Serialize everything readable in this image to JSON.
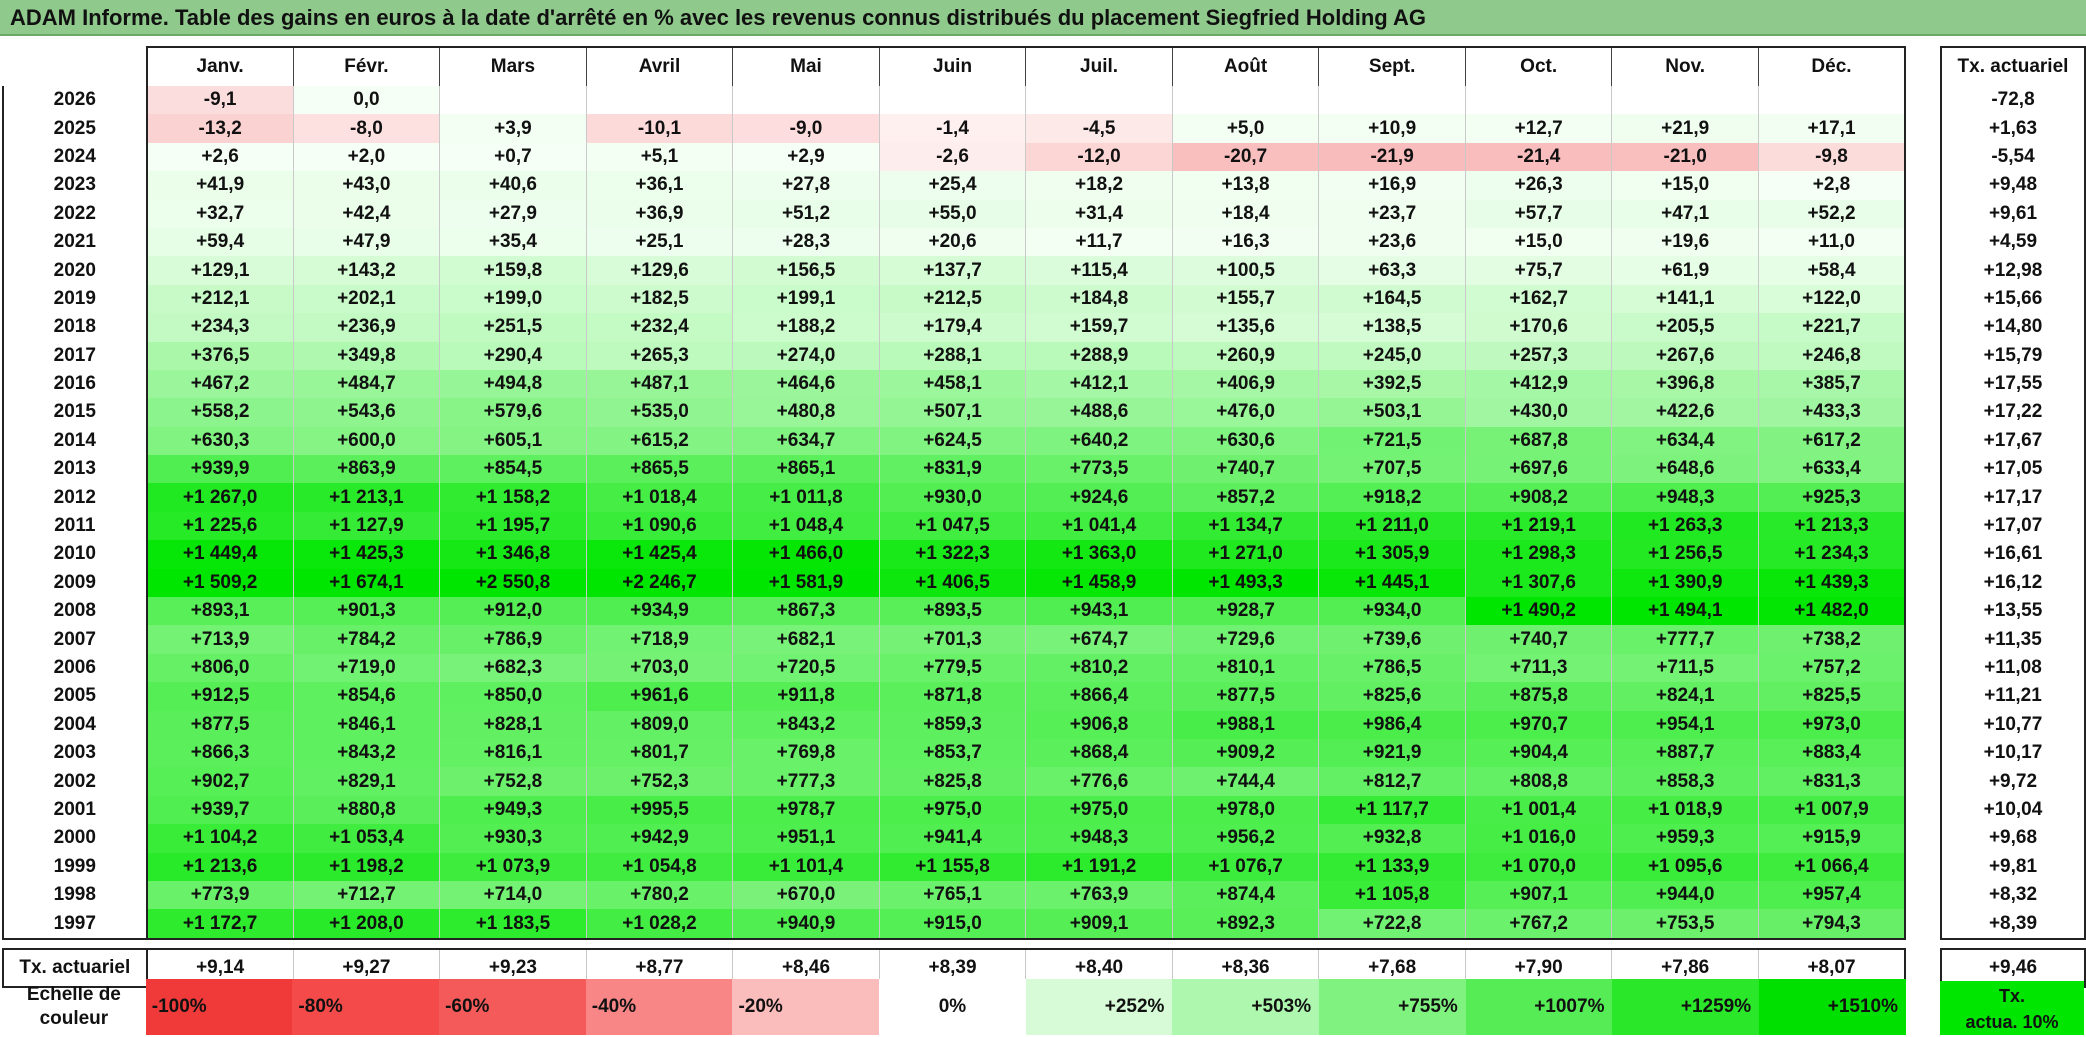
{
  "title": "ADAM Informe. Table des gains en euros à la date d'arrêté en % avec les revenus connus distribués du placement Siegfried Holding AG",
  "months": [
    "Janv.",
    "Févr.",
    "Mars",
    "Avril",
    "Mai",
    "Juin",
    "Juil.",
    "Août",
    "Sept.",
    "Oct.",
    "Nov.",
    "Déc."
  ],
  "side_header": "Tx. actuariel",
  "rows": [
    {
      "year": "2026",
      "cells": [
        "-9,1",
        "0,0",
        "",
        "",
        "",
        "",
        "",
        "",
        "",
        "",
        "",
        ""
      ],
      "tx": "-72,8"
    },
    {
      "year": "2025",
      "cells": [
        "-13,2",
        "-8,0",
        "+3,9",
        "-10,1",
        "-9,0",
        "-1,4",
        "-4,5",
        "+5,0",
        "+10,9",
        "+12,7",
        "+21,9",
        "+17,1"
      ],
      "tx": "+1,63"
    },
    {
      "year": "2024",
      "cells": [
        "+2,6",
        "+2,0",
        "+0,7",
        "+5,1",
        "+2,9",
        "-2,6",
        "-12,0",
        "-20,7",
        "-21,9",
        "-21,4",
        "-21,0",
        "-9,8"
      ],
      "tx": "-5,54"
    },
    {
      "year": "2023",
      "cells": [
        "+41,9",
        "+43,0",
        "+40,6",
        "+36,1",
        "+27,8",
        "+25,4",
        "+18,2",
        "+13,8",
        "+16,9",
        "+26,3",
        "+15,0",
        "+2,8"
      ],
      "tx": "+9,48"
    },
    {
      "year": "2022",
      "cells": [
        "+32,7",
        "+42,4",
        "+27,9",
        "+36,9",
        "+51,2",
        "+55,0",
        "+31,4",
        "+18,4",
        "+23,7",
        "+57,7",
        "+47,1",
        "+52,2"
      ],
      "tx": "+9,61"
    },
    {
      "year": "2021",
      "cells": [
        "+59,4",
        "+47,9",
        "+35,4",
        "+25,1",
        "+28,3",
        "+20,6",
        "+11,7",
        "+16,3",
        "+23,6",
        "+15,0",
        "+19,6",
        "+11,0"
      ],
      "tx": "+4,59"
    },
    {
      "year": "2020",
      "cells": [
        "+129,1",
        "+143,2",
        "+159,8",
        "+129,6",
        "+156,5",
        "+137,7",
        "+115,4",
        "+100,5",
        "+63,3",
        "+75,7",
        "+61,9",
        "+58,4"
      ],
      "tx": "+12,98"
    },
    {
      "year": "2019",
      "cells": [
        "+212,1",
        "+202,1",
        "+199,0",
        "+182,5",
        "+199,1",
        "+212,5",
        "+184,8",
        "+155,7",
        "+164,5",
        "+162,7",
        "+141,1",
        "+122,0"
      ],
      "tx": "+15,66"
    },
    {
      "year": "2018",
      "cells": [
        "+234,3",
        "+236,9",
        "+251,5",
        "+232,4",
        "+188,2",
        "+179,4",
        "+159,7",
        "+135,6",
        "+138,5",
        "+170,6",
        "+205,5",
        "+221,7"
      ],
      "tx": "+14,80"
    },
    {
      "year": "2017",
      "cells": [
        "+376,5",
        "+349,8",
        "+290,4",
        "+265,3",
        "+274,0",
        "+288,1",
        "+288,9",
        "+260,9",
        "+245,0",
        "+257,3",
        "+267,6",
        "+246,8"
      ],
      "tx": "+15,79"
    },
    {
      "year": "2016",
      "cells": [
        "+467,2",
        "+484,7",
        "+494,8",
        "+487,1",
        "+464,6",
        "+458,1",
        "+412,1",
        "+406,9",
        "+392,5",
        "+412,9",
        "+396,8",
        "+385,7"
      ],
      "tx": "+17,55"
    },
    {
      "year": "2015",
      "cells": [
        "+558,2",
        "+543,6",
        "+579,6",
        "+535,0",
        "+480,8",
        "+507,1",
        "+488,6",
        "+476,0",
        "+503,1",
        "+430,0",
        "+422,6",
        "+433,3"
      ],
      "tx": "+17,22"
    },
    {
      "year": "2014",
      "cells": [
        "+630,3",
        "+600,0",
        "+605,1",
        "+615,2",
        "+634,7",
        "+624,5",
        "+640,2",
        "+630,6",
        "+721,5",
        "+687,8",
        "+634,4",
        "+617,2"
      ],
      "tx": "+17,67"
    },
    {
      "year": "2013",
      "cells": [
        "+939,9",
        "+863,9",
        "+854,5",
        "+865,5",
        "+865,1",
        "+831,9",
        "+773,5",
        "+740,7",
        "+707,5",
        "+697,6",
        "+648,6",
        "+633,4"
      ],
      "tx": "+17,05"
    },
    {
      "year": "2012",
      "cells": [
        "+1 267,0",
        "+1 213,1",
        "+1 158,2",
        "+1 018,4",
        "+1 011,8",
        "+930,0",
        "+924,6",
        "+857,2",
        "+918,2",
        "+908,2",
        "+948,3",
        "+925,3"
      ],
      "tx": "+17,17"
    },
    {
      "year": "2011",
      "cells": [
        "+1 225,6",
        "+1 127,9",
        "+1 195,7",
        "+1 090,6",
        "+1 048,4",
        "+1 047,5",
        "+1 041,4",
        "+1 134,7",
        "+1 211,0",
        "+1 219,1",
        "+1 263,3",
        "+1 213,3"
      ],
      "tx": "+17,07"
    },
    {
      "year": "2010",
      "cells": [
        "+1 449,4",
        "+1 425,3",
        "+1 346,8",
        "+1 425,4",
        "+1 466,0",
        "+1 322,3",
        "+1 363,0",
        "+1 271,0",
        "+1 305,9",
        "+1 298,3",
        "+1 256,5",
        "+1 234,3"
      ],
      "tx": "+16,61"
    },
    {
      "year": "2009",
      "cells": [
        "+1 509,2",
        "+1 674,1",
        "+2 550,8",
        "+2 246,7",
        "+1 581,9",
        "+1 406,5",
        "+1 458,9",
        "+1 493,3",
        "+1 445,1",
        "+1 307,6",
        "+1 390,9",
        "+1 439,3"
      ],
      "tx": "+16,12"
    },
    {
      "year": "2008",
      "cells": [
        "+893,1",
        "+901,3",
        "+912,0",
        "+934,9",
        "+867,3",
        "+893,5",
        "+943,1",
        "+928,7",
        "+934,0",
        "+1 490,2",
        "+1 494,1",
        "+1 482,0"
      ],
      "tx": "+13,55"
    },
    {
      "year": "2007",
      "cells": [
        "+713,9",
        "+784,2",
        "+786,9",
        "+718,9",
        "+682,1",
        "+701,3",
        "+674,7",
        "+729,6",
        "+739,6",
        "+740,7",
        "+777,7",
        "+738,2"
      ],
      "tx": "+11,35"
    },
    {
      "year": "2006",
      "cells": [
        "+806,0",
        "+719,0",
        "+682,3",
        "+703,0",
        "+720,5",
        "+779,5",
        "+810,2",
        "+810,1",
        "+786,5",
        "+711,3",
        "+711,5",
        "+757,2"
      ],
      "tx": "+11,08"
    },
    {
      "year": "2005",
      "cells": [
        "+912,5",
        "+854,6",
        "+850,0",
        "+961,6",
        "+911,8",
        "+871,8",
        "+866,4",
        "+877,5",
        "+825,6",
        "+875,8",
        "+824,1",
        "+825,5"
      ],
      "tx": "+11,21"
    },
    {
      "year": "2004",
      "cells": [
        "+877,5",
        "+846,1",
        "+828,1",
        "+809,0",
        "+843,2",
        "+859,3",
        "+906,8",
        "+988,1",
        "+986,4",
        "+970,7",
        "+954,1",
        "+973,0"
      ],
      "tx": "+10,77"
    },
    {
      "year": "2003",
      "cells": [
        "+866,3",
        "+843,2",
        "+816,1",
        "+801,7",
        "+769,8",
        "+853,7",
        "+868,4",
        "+909,2",
        "+921,9",
        "+904,4",
        "+887,7",
        "+883,4"
      ],
      "tx": "+10,17"
    },
    {
      "year": "2002",
      "cells": [
        "+902,7",
        "+829,1",
        "+752,8",
        "+752,3",
        "+777,3",
        "+825,8",
        "+776,6",
        "+744,4",
        "+812,7",
        "+808,8",
        "+858,3",
        "+831,3"
      ],
      "tx": "+9,72"
    },
    {
      "year": "2001",
      "cells": [
        "+939,7",
        "+880,8",
        "+949,3",
        "+995,5",
        "+978,7",
        "+975,0",
        "+975,0",
        "+978,0",
        "+1 117,7",
        "+1 001,4",
        "+1 018,9",
        "+1 007,9"
      ],
      "tx": "+10,04"
    },
    {
      "year": "2000",
      "cells": [
        "+1 104,2",
        "+1 053,4",
        "+930,3",
        "+942,9",
        "+951,1",
        "+941,4",
        "+948,3",
        "+956,2",
        "+932,8",
        "+1 016,0",
        "+959,3",
        "+915,9"
      ],
      "tx": "+9,68"
    },
    {
      "year": "1999",
      "cells": [
        "+1 213,6",
        "+1 198,2",
        "+1 073,9",
        "+1 054,8",
        "+1 101,4",
        "+1 155,8",
        "+1 191,2",
        "+1 076,7",
        "+1 133,9",
        "+1 070,0",
        "+1 095,6",
        "+1 066,4"
      ],
      "tx": "+9,81"
    },
    {
      "year": "1998",
      "cells": [
        "+773,9",
        "+712,7",
        "+714,0",
        "+780,2",
        "+670,0",
        "+765,1",
        "+763,9",
        "+874,4",
        "+1 105,8",
        "+907,1",
        "+944,0",
        "+957,4"
      ],
      "tx": "+8,32"
    },
    {
      "year": "1997",
      "cells": [
        "+1 172,7",
        "+1 208,0",
        "+1 183,5",
        "+1 028,2",
        "+940,9",
        "+915,0",
        "+909,1",
        "+892,3",
        "+722,8",
        "+767,2",
        "+753,5",
        "+794,3"
      ],
      "tx": "+8,39"
    }
  ],
  "summary": {
    "label": "Tx. actuariel",
    "cells": [
      "+9,14",
      "+9,27",
      "+9,23",
      "+8,77",
      "+8,46",
      "+8,39",
      "+8,40",
      "+8,36",
      "+7,68",
      "+7,90",
      "+7,86",
      "+8,07"
    ],
    "tx": "+9,46"
  },
  "scale": {
    "label_line1": "Echelle de",
    "label_line2": "couleur",
    "items": [
      {
        "text": "-100%",
        "color": "#f03a3a"
      },
      {
        "text": "-80%",
        "color": "#f44a4a"
      },
      {
        "text": "-60%",
        "color": "#f55a5a"
      },
      {
        "text": "-40%",
        "color": "#f88686"
      },
      {
        "text": "-20%",
        "color": "#fbbcbc"
      },
      {
        "text": "0%",
        "color": "#ffffff"
      },
      {
        "text": "+252%",
        "color": "#d6fbd6"
      },
      {
        "text": "+503%",
        "color": "#aef7ae"
      },
      {
        "text": "+755%",
        "color": "#80f280"
      },
      {
        "text": "+1007%",
        "color": "#55ec55"
      },
      {
        "text": "+1259%",
        "color": "#2ae72a"
      },
      {
        "text": "+1510%",
        "color": "#00e000"
      }
    ],
    "tx_legend_line1": "Tx.",
    "tx_legend_line2": "actua. 10%"
  },
  "colors": {
    "title_bg": "#8fc98b",
    "neg_max": "#f03a3a",
    "pos_max": "#00e000"
  }
}
